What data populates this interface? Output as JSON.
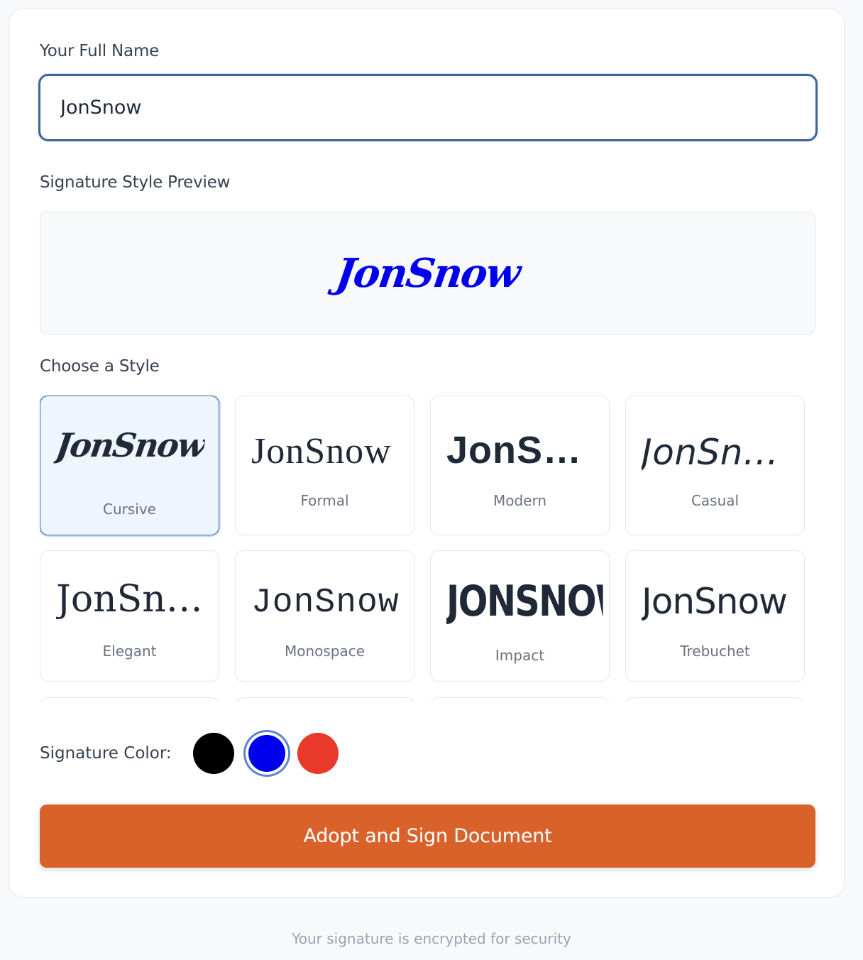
{
  "form": {
    "name_label": "Your Full Name",
    "name_value": "JonSnow",
    "preview_label": "Signature Style Preview",
    "preview_text": "JonSnow",
    "choose_label": "Choose a Style",
    "color_label": "Signature Color:",
    "submit_label": "Adopt and Sign Document"
  },
  "styles": [
    {
      "sample": "JonSnow",
      "name": "Cursive",
      "selected": true
    },
    {
      "sample": "JonSnow",
      "name": "Formal",
      "selected": false
    },
    {
      "sample": "JonSnow",
      "name": "Modern",
      "selected": false
    },
    {
      "sample": "JonSnow",
      "name": "Casual",
      "selected": false
    },
    {
      "sample": "JonSnow",
      "name": "Elegant",
      "selected": false
    },
    {
      "sample": "JonSnow",
      "name": "Monospace",
      "selected": false
    },
    {
      "sample": "JONSNOW",
      "name": "Impact",
      "selected": false
    },
    {
      "sample": "JonSnow",
      "name": "Trebuchet",
      "selected": false
    }
  ],
  "colors": {
    "swatches": [
      "#000000",
      "#0000ee",
      "#e8392a"
    ],
    "selected": "#0000ee",
    "accent": "#d9622b",
    "text_dark": "#1f2937"
  },
  "footer": {
    "note": "Your signature is encrypted for security"
  }
}
